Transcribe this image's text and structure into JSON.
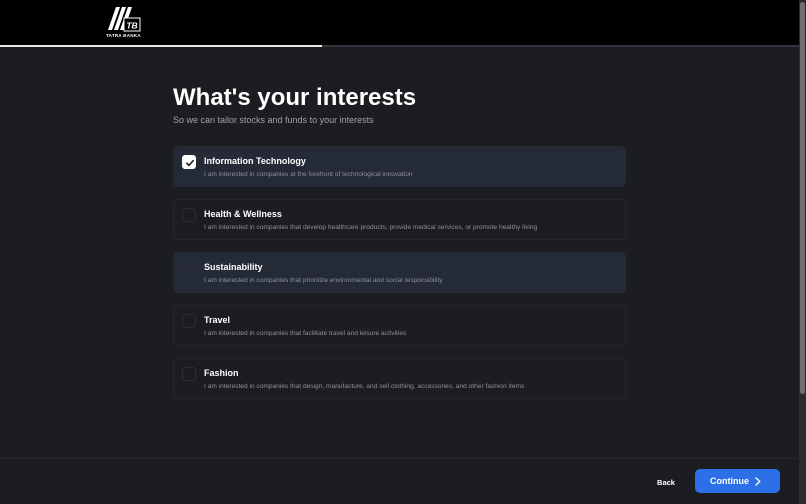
{
  "header": {
    "logo_text": "TATRA BANKA",
    "logo_initials": "TB",
    "progress_percent": 40
  },
  "page": {
    "title": "What's your interests",
    "subtitle": "So we can tailor stocks and funds to your interests"
  },
  "options": [
    {
      "title": "Information Technology",
      "description": "I am interested in companies at the forefront of technological innovation",
      "checked": true,
      "highlighted": true,
      "icon": "check-icon"
    },
    {
      "title": "Health & Wellness",
      "description": "I am interested in companies that develop healthcare products, provide medical services, or promote healthy living",
      "checked": false,
      "highlighted": false
    },
    {
      "title": "Sustainability",
      "description": "I am interested in companies that prioritize environmental and social responsibility",
      "checked": false,
      "highlighted": true
    },
    {
      "title": "Travel",
      "description": "I am interested in companies that facilitate travel and leisure activities",
      "checked": false,
      "highlighted": false
    },
    {
      "title": "Fashion",
      "description": "I am interested in companies that design, manufacture, and sell clothing, accessories, and other fashion items",
      "checked": false,
      "highlighted": false
    }
  ],
  "footer": {
    "back_label": "Back",
    "continue_label": "Continue",
    "continue_icon": "chevron-right-icon"
  },
  "colors": {
    "background": "#1c1d21",
    "header": "#000000",
    "accent": "#2c6fe6",
    "highlight": "#252a37"
  }
}
